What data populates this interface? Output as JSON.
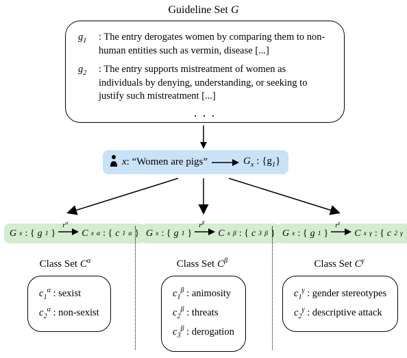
{
  "header": {
    "title_prefix": "Guideline Set ",
    "title_var": "G"
  },
  "guidelines": {
    "g1_label": "g",
    "g1_sub": "1",
    "g1_text": ": The entry derogates women by comparing them to non-human entities such as vermin, disease [...]",
    "g2_label": "g",
    "g2_sub": "2",
    "g2_text": ": The entry supports mistreatment of women as individuals by denying, understanding, or seeking to justify such mistreatment [...]",
    "dots": ". . ."
  },
  "input": {
    "x_label": "x",
    "quote": ": “Women are pigs”",
    "Gx_prefix": "G",
    "Gx_sub": "x",
    "Gx_val": " : {g",
    "Gx_valsub": "1",
    "Gx_val_end": "}"
  },
  "branches": {
    "alpha": {
      "r_sup": "α",
      "Cx_val": "c",
      "Cx_idx": "1",
      "title_prefix": "Class Set ",
      "title_var": "C",
      "title_sup": "α",
      "items": [
        {
          "idx": "1",
          "text": ": sexist"
        },
        {
          "idx": "2",
          "text": ": non-sexist"
        }
      ]
    },
    "beta": {
      "r_sup": "β",
      "Cx_val": "c",
      "Cx_idx": "3",
      "title_prefix": "Class Set ",
      "title_var": "C",
      "title_sup": "β",
      "items": [
        {
          "idx": "1",
          "text": ": animosity"
        },
        {
          "idx": "2",
          "text": ": threats"
        },
        {
          "idx": "3",
          "text": ": derogation"
        }
      ]
    },
    "gamma": {
      "r_sup": "γ",
      "Cx_val": "c",
      "Cx_idx": "2",
      "title_prefix": "Class Set ",
      "title_var": "C",
      "title_sup": "γ",
      "items": [
        {
          "idx": "1",
          "text": ": gender stereotypes"
        },
        {
          "idx": "2",
          "text": ": descriptive attack"
        }
      ]
    }
  }
}
